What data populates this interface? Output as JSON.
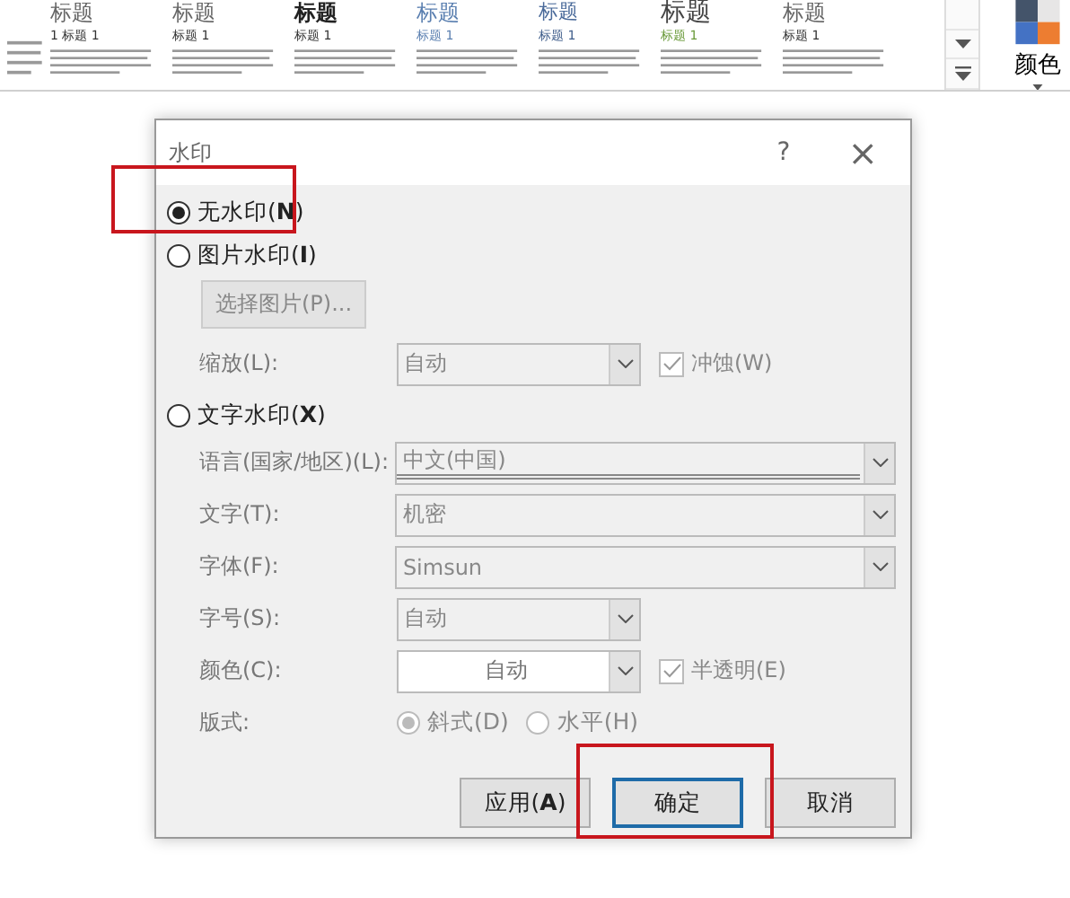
{
  "ribbon": {
    "styles": [
      {
        "title": "标题",
        "heading": "1  标题 1"
      },
      {
        "title": "标题",
        "heading": "标题 1"
      },
      {
        "title": "标题",
        "heading": "标题 1"
      },
      {
        "title": "标题",
        "heading": "标题 1"
      },
      {
        "title": "标题",
        "heading": "标题 1"
      },
      {
        "title": "标题",
        "heading": "标题 1"
      },
      {
        "title": "标题",
        "heading": "标题 1"
      }
    ],
    "colors_label": "颜色"
  },
  "dialog": {
    "title": "水印",
    "help": "?",
    "close": "×",
    "no_watermark": {
      "label": "无水印(**N**)",
      "selected": true
    },
    "picture_watermark": {
      "label": "图片水印(**I**)",
      "selected": false
    },
    "select_picture_button": "选择图片(P)...",
    "scale": {
      "label": "缩放(L):",
      "value": "自动"
    },
    "washout": {
      "label": "冲蚀(W)",
      "checked": true,
      "disabled": true
    },
    "text_watermark": {
      "label": "文字水印(**X**)",
      "selected": false
    },
    "fields": [
      {
        "label": "语言(国家/地区)(L):",
        "value": "中文(中国)",
        "wide": true
      },
      {
        "label": "文字(T):",
        "value": "机密",
        "wide": true
      },
      {
        "label": "字体(F):",
        "value": "Simsun",
        "wide": true
      },
      {
        "label": "字号(S):",
        "value": "自动",
        "wide": false
      }
    ],
    "color": {
      "label": "颜色(C):",
      "value": "自动"
    },
    "semitransparent": {
      "label": "半透明(E)",
      "checked": true,
      "disabled": true
    },
    "layout": {
      "label": "版式:",
      "options": [
        {
          "label": "斜式(D)",
          "selected": true
        },
        {
          "label": "水平(H)",
          "selected": false
        }
      ]
    },
    "buttons": [
      {
        "label": "应用(**A**)",
        "default": false
      },
      {
        "label": "确定",
        "default": true
      },
      {
        "label": "取消",
        "default": false
      }
    ]
  }
}
